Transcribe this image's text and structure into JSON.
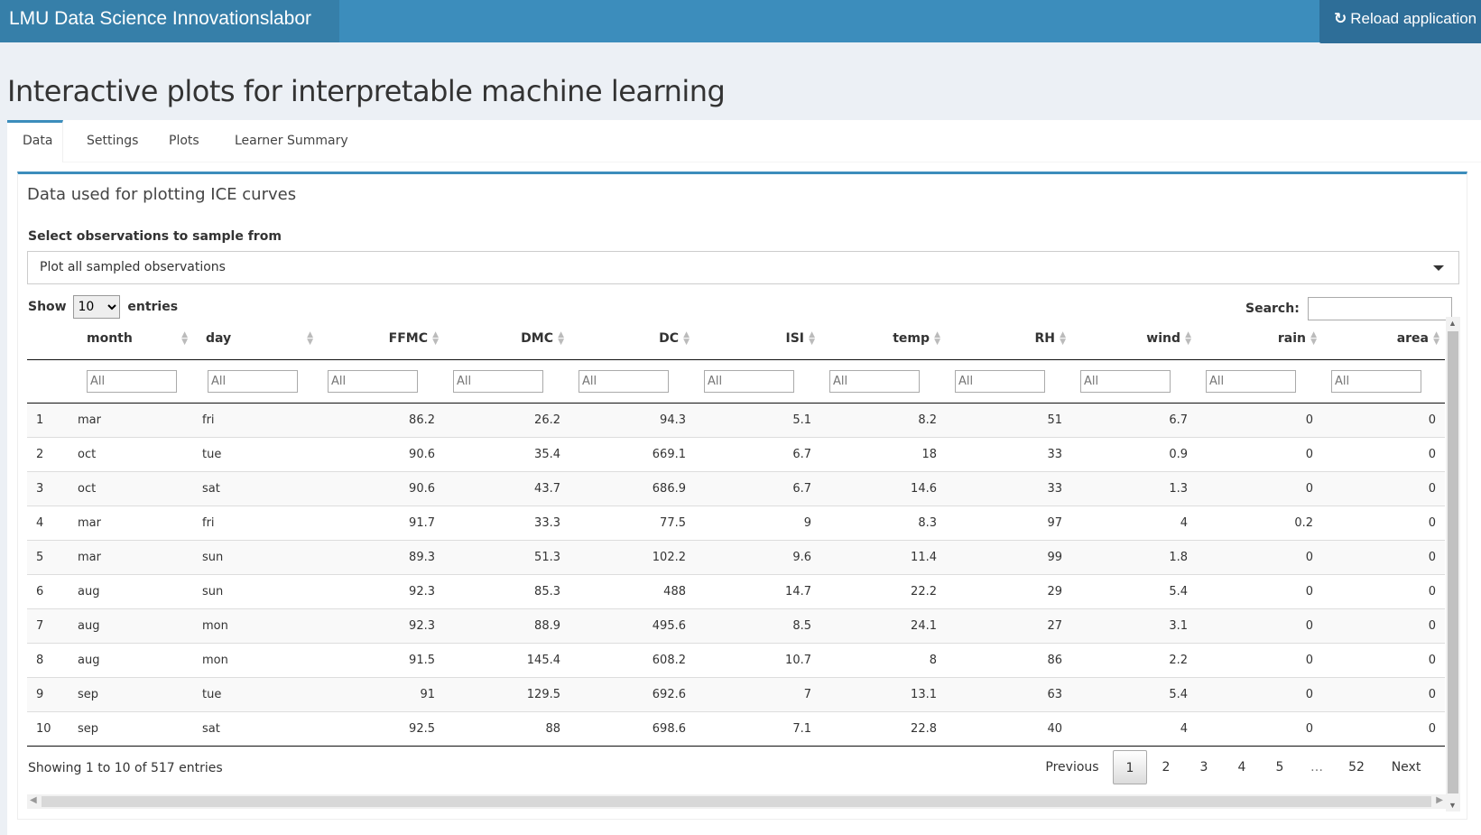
{
  "header": {
    "brand": "LMU Data Science Innovationslabor",
    "reload_label": "Reload application",
    "reload_icon": "refresh-icon"
  },
  "page_title": "Interactive plots for interpretable machine learning",
  "tabs": [
    {
      "label": "Data",
      "active": true
    },
    {
      "label": "Settings",
      "active": false
    },
    {
      "label": "Plots",
      "active": false
    },
    {
      "label": "Learner Summary",
      "active": false
    }
  ],
  "box": {
    "title": "Data used for plotting ICE curves",
    "select_label": "Select observations to sample from",
    "select_value": "Plot all sampled observations"
  },
  "table_controls": {
    "show_label": "Show",
    "length_value": "10",
    "entries_label": "entries",
    "search_label": "Search:",
    "search_value": ""
  },
  "columns": [
    "",
    "month",
    "day",
    "FFMC",
    "DMC",
    "DC",
    "ISI",
    "temp",
    "RH",
    "wind",
    "rain",
    "area"
  ],
  "filter_placeholder": "All",
  "rows": [
    [
      "1",
      "mar",
      "fri",
      "86.2",
      "26.2",
      "94.3",
      "5.1",
      "8.2",
      "51",
      "6.7",
      "0",
      "0"
    ],
    [
      "2",
      "oct",
      "tue",
      "90.6",
      "35.4",
      "669.1",
      "6.7",
      "18",
      "33",
      "0.9",
      "0",
      "0"
    ],
    [
      "3",
      "oct",
      "sat",
      "90.6",
      "43.7",
      "686.9",
      "6.7",
      "14.6",
      "33",
      "1.3",
      "0",
      "0"
    ],
    [
      "4",
      "mar",
      "fri",
      "91.7",
      "33.3",
      "77.5",
      "9",
      "8.3",
      "97",
      "4",
      "0.2",
      "0"
    ],
    [
      "5",
      "mar",
      "sun",
      "89.3",
      "51.3",
      "102.2",
      "9.6",
      "11.4",
      "99",
      "1.8",
      "0",
      "0"
    ],
    [
      "6",
      "aug",
      "sun",
      "92.3",
      "85.3",
      "488",
      "14.7",
      "22.2",
      "29",
      "5.4",
      "0",
      "0"
    ],
    [
      "7",
      "aug",
      "mon",
      "92.3",
      "88.9",
      "495.6",
      "8.5",
      "24.1",
      "27",
      "3.1",
      "0",
      "0"
    ],
    [
      "8",
      "aug",
      "mon",
      "91.5",
      "145.4",
      "608.2",
      "10.7",
      "8",
      "86",
      "2.2",
      "0",
      "0"
    ],
    [
      "9",
      "sep",
      "tue",
      "91",
      "129.5",
      "692.6",
      "7",
      "13.1",
      "63",
      "5.4",
      "0",
      "0"
    ],
    [
      "10",
      "sep",
      "sat",
      "92.5",
      "88",
      "698.6",
      "7.1",
      "22.8",
      "40",
      "4",
      "0",
      "0"
    ]
  ],
  "info": "Showing 1 to 10 of 517 entries",
  "pagination": {
    "previous": "Previous",
    "pages": [
      "1",
      "2",
      "3",
      "4",
      "5",
      "…",
      "52"
    ],
    "current": "1",
    "next": "Next"
  },
  "colors": {
    "header_bg": "#3c8dbc",
    "brand_bg": "#367fa9",
    "accent": "#3c8dbc",
    "page_bg": "#ecf0f5"
  }
}
